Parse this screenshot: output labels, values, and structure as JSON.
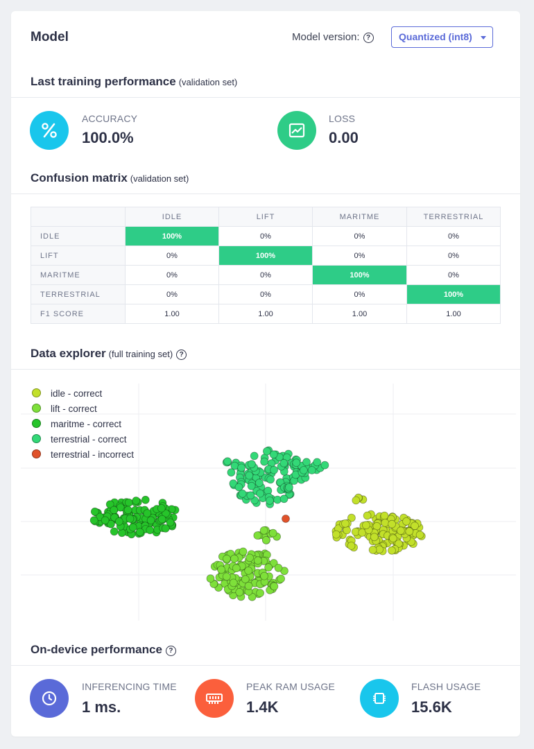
{
  "header": {
    "title": "Model",
    "version_label": "Model version:",
    "version_value": "Quantized (int8)"
  },
  "training": {
    "title": "Last training performance",
    "subtitle": "(validation set)",
    "accuracy_label": "ACCURACY",
    "accuracy_value": "100.0%",
    "loss_label": "LOSS",
    "loss_value": "0.00"
  },
  "confusion": {
    "title": "Confusion matrix",
    "subtitle": "(validation set)",
    "columns": [
      "IDLE",
      "LIFT",
      "MARITME",
      "TERRESTRIAL"
    ],
    "rows": [
      {
        "label": "IDLE",
        "cells": [
          "100%",
          "0%",
          "0%",
          "0%"
        ]
      },
      {
        "label": "LIFT",
        "cells": [
          "0%",
          "100%",
          "0%",
          "0%"
        ]
      },
      {
        "label": "MARITME",
        "cells": [
          "0%",
          "0%",
          "100%",
          "0%"
        ]
      },
      {
        "label": "TERRESTRIAL",
        "cells": [
          "0%",
          "0%",
          "0%",
          "100%"
        ]
      }
    ],
    "f1": {
      "label": "F1 SCORE",
      "cells": [
        "1.00",
        "1.00",
        "1.00",
        "1.00"
      ]
    },
    "highlight_color": "#2ecc87"
  },
  "explorer": {
    "title": "Data explorer",
    "subtitle": "(full training set)",
    "legend": [
      {
        "label": "idle - correct",
        "color": "#c2e02a"
      },
      {
        "label": "lift - correct",
        "color": "#7ee03a"
      },
      {
        "label": "maritme - correct",
        "color": "#26c42a"
      },
      {
        "label": "terrestrial - correct",
        "color": "#33d877"
      },
      {
        "label": "terrestrial - incorrect",
        "color": "#e0522a"
      }
    ]
  },
  "device": {
    "title": "On-device performance",
    "items": [
      {
        "label": "INFERENCING TIME",
        "value": "1 ms.",
        "icon": "clock-icon",
        "color": "#5a6ad8"
      },
      {
        "label": "PEAK RAM USAGE",
        "value": "1.4K",
        "icon": "memory-icon",
        "color": "#fb5f3c"
      },
      {
        "label": "FLASH USAGE",
        "value": "15.6K",
        "icon": "chip-icon",
        "color": "#19c6ec"
      }
    ]
  }
}
